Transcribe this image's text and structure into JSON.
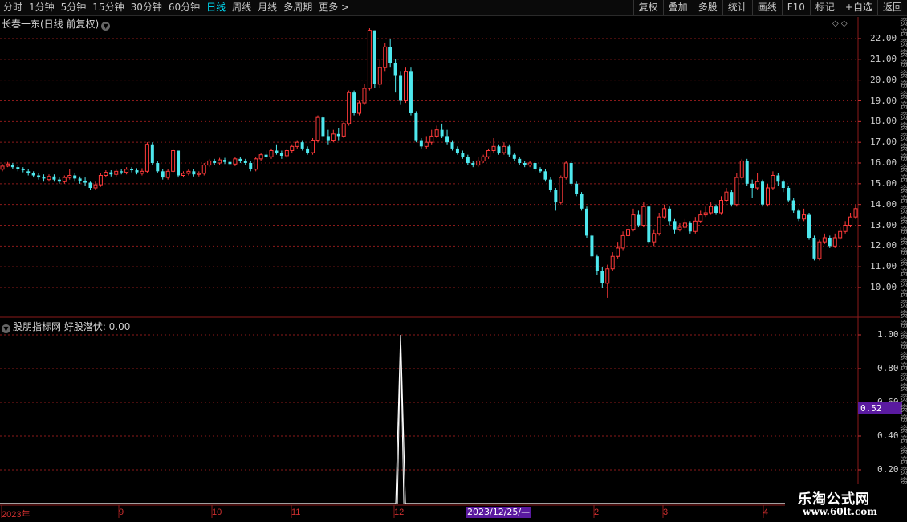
{
  "toolbar": {
    "left": [
      "分时",
      "1分钟",
      "5分钟",
      "15分钟",
      "30分钟",
      "60分钟",
      "日线",
      "周线",
      "月线",
      "多周期",
      "更多 >"
    ],
    "active_index": 6,
    "right": [
      "复权",
      "叠加",
      "多股",
      "统计",
      "画线",
      "F10",
      "标记",
      "+自选",
      "返回"
    ]
  },
  "main_panel": {
    "title": "长春一东(日线 前复权)",
    "y_labels": [
      "22.00",
      "21.00",
      "20.00",
      "19.00",
      "18.00",
      "17.00",
      "16.00",
      "15.00",
      "14.00",
      "13.00",
      "12.00",
      "11.00",
      "10.00"
    ]
  },
  "indicator_panel": {
    "title": "股朋指标网 好股潜伏: 0.00",
    "y_labels": [
      "1.00",
      "0.80",
      "0.60",
      "0.40",
      "0.20"
    ],
    "current_value": "0.52"
  },
  "x_axis": {
    "labels": [
      "2023年",
      "9",
      "10",
      "11",
      "12",
      "2",
      "3",
      "4"
    ],
    "crosshair_date": "2023/12/25/—"
  },
  "watermark": {
    "line1": "乐淘公式网",
    "line2": "www.60lt.com"
  },
  "colors": {
    "up": "#ff3a3a",
    "down": "#4ee8ee",
    "grid": "#8b1a1a",
    "indicator": "#ffffff"
  },
  "chart_data": {
    "type": "candlestick",
    "title": "长春一东(日线 前复权)",
    "ylim": [
      9.3,
      22.5
    ],
    "ticks": [
      22,
      21,
      20,
      19,
      18,
      17,
      16,
      15,
      14,
      13,
      12,
      11,
      10
    ],
    "candles": [
      [
        15.7,
        15.85,
        15.95,
        15.6
      ],
      [
        15.85,
        15.95,
        16.05,
        15.8
      ],
      [
        15.9,
        15.8,
        16.0,
        15.7
      ],
      [
        15.8,
        15.7,
        15.9,
        15.6
      ],
      [
        15.7,
        15.65,
        15.8,
        15.55
      ],
      [
        15.6,
        15.5,
        15.7,
        15.4
      ],
      [
        15.5,
        15.4,
        15.6,
        15.3
      ],
      [
        15.4,
        15.3,
        15.5,
        15.2
      ],
      [
        15.3,
        15.25,
        15.45,
        15.1
      ],
      [
        15.2,
        15.35,
        15.45,
        15.1
      ],
      [
        15.35,
        15.2,
        15.45,
        15.1
      ],
      [
        15.2,
        15.1,
        15.3,
        15.0
      ],
      [
        15.1,
        15.3,
        15.4,
        15.0
      ],
      [
        15.3,
        15.4,
        15.7,
        15.2
      ],
      [
        15.4,
        15.25,
        15.5,
        15.1
      ],
      [
        15.25,
        15.15,
        15.35,
        15.0
      ],
      [
        15.15,
        15.05,
        15.3,
        14.9
      ],
      [
        15.05,
        14.8,
        15.1,
        14.7
      ],
      [
        14.8,
        14.95,
        15.1,
        14.7
      ],
      [
        14.95,
        15.4,
        15.5,
        14.85
      ],
      [
        15.4,
        15.55,
        15.65,
        15.3
      ],
      [
        15.55,
        15.45,
        15.65,
        15.35
      ],
      [
        15.45,
        15.6,
        15.7,
        15.35
      ],
      [
        15.6,
        15.55,
        15.7,
        15.45
      ],
      [
        15.55,
        15.7,
        15.8,
        15.45
      ],
      [
        15.7,
        15.65,
        15.8,
        15.55
      ],
      [
        15.65,
        15.55,
        15.75,
        15.45
      ],
      [
        15.5,
        15.6,
        15.75,
        15.4
      ],
      [
        15.6,
        16.9,
        17.0,
        15.5
      ],
      [
        16.9,
        16.0,
        17.0,
        15.9
      ],
      [
        16.0,
        15.6,
        16.1,
        15.5
      ],
      [
        15.6,
        15.3,
        15.7,
        15.2
      ],
      [
        15.3,
        15.6,
        15.7,
        15.2
      ],
      [
        15.6,
        16.6,
        16.7,
        15.5
      ],
      [
        16.6,
        15.4,
        16.6,
        15.3
      ],
      [
        15.4,
        15.5,
        15.6,
        15.3
      ],
      [
        15.5,
        15.6,
        15.7,
        15.4
      ],
      [
        15.6,
        15.45,
        15.7,
        15.35
      ],
      [
        15.45,
        15.5,
        15.6,
        15.35
      ],
      [
        15.5,
        15.9,
        16.0,
        15.4
      ],
      [
        15.9,
        16.1,
        16.2,
        15.8
      ],
      [
        16.1,
        16.0,
        16.2,
        15.9
      ],
      [
        16.0,
        16.15,
        16.25,
        15.9
      ],
      [
        16.15,
        16.05,
        16.25,
        15.95
      ],
      [
        16.05,
        15.95,
        16.15,
        15.85
      ],
      [
        15.95,
        16.2,
        16.3,
        15.85
      ],
      [
        16.2,
        16.1,
        16.3,
        16.0
      ],
      [
        16.1,
        16.0,
        16.2,
        15.9
      ],
      [
        16.0,
        15.7,
        16.1,
        15.6
      ],
      [
        15.7,
        16.2,
        16.3,
        15.6
      ],
      [
        16.2,
        16.4,
        16.5,
        16.1
      ],
      [
        16.4,
        16.3,
        16.6,
        16.2
      ],
      [
        16.3,
        16.6,
        16.7,
        16.2
      ],
      [
        16.6,
        16.5,
        16.9,
        16.4
      ],
      [
        16.5,
        16.35,
        16.6,
        16.2
      ],
      [
        16.35,
        16.6,
        16.7,
        16.25
      ],
      [
        16.6,
        16.8,
        16.9,
        16.5
      ],
      [
        16.8,
        17.0,
        17.1,
        16.7
      ],
      [
        17.0,
        16.7,
        17.1,
        16.6
      ],
      [
        16.7,
        16.5,
        16.8,
        16.4
      ],
      [
        16.5,
        17.1,
        17.2,
        16.4
      ],
      [
        17.1,
        18.2,
        18.3,
        17.0
      ],
      [
        18.2,
        17.3,
        18.3,
        17.1
      ],
      [
        17.3,
        17.1,
        17.6,
        16.9
      ],
      [
        17.1,
        17.4,
        17.6,
        17.0
      ],
      [
        17.4,
        17.3,
        17.7,
        17.1
      ],
      [
        17.3,
        17.9,
        18.0,
        17.2
      ],
      [
        17.9,
        19.4,
        19.5,
        17.8
      ],
      [
        19.4,
        18.4,
        19.5,
        18.3
      ],
      [
        18.4,
        18.9,
        19.0,
        18.3
      ],
      [
        18.9,
        19.6,
        19.8,
        18.8
      ],
      [
        19.6,
        22.4,
        22.5,
        19.5
      ],
      [
        22.4,
        19.8,
        22.4,
        19.6
      ],
      [
        19.8,
        20.6,
        21.0,
        19.6
      ],
      [
        20.6,
        21.6,
        21.8,
        20.4
      ],
      [
        21.6,
        20.8,
        22.0,
        20.6
      ],
      [
        20.8,
        20.2,
        21.0,
        19.4
      ],
      [
        20.2,
        19.0,
        20.4,
        18.8
      ],
      [
        19.0,
        20.4,
        20.6,
        18.9
      ],
      [
        20.4,
        18.4,
        20.6,
        18.3
      ],
      [
        18.4,
        17.1,
        18.5,
        17.0
      ],
      [
        17.1,
        16.8,
        17.2,
        16.7
      ],
      [
        16.8,
        17.0,
        17.3,
        16.7
      ],
      [
        17.0,
        17.3,
        17.6,
        16.9
      ],
      [
        17.3,
        17.6,
        17.8,
        17.2
      ],
      [
        17.6,
        17.3,
        17.9,
        17.2
      ],
      [
        17.3,
        17.0,
        17.6,
        16.9
      ],
      [
        17.0,
        16.7,
        17.1,
        16.6
      ],
      [
        16.7,
        16.5,
        16.8,
        16.4
      ],
      [
        16.5,
        16.3,
        16.6,
        16.2
      ],
      [
        16.3,
        16.0,
        16.4,
        15.9
      ],
      [
        16.0,
        15.9,
        16.1,
        15.8
      ],
      [
        15.9,
        16.1,
        16.3,
        15.8
      ],
      [
        16.1,
        16.3,
        16.4,
        16.0
      ],
      [
        16.3,
        16.6,
        16.7,
        16.2
      ],
      [
        16.6,
        16.8,
        17.2,
        16.5
      ],
      [
        16.8,
        16.5,
        16.9,
        16.4
      ],
      [
        16.5,
        16.8,
        17.0,
        16.4
      ],
      [
        16.8,
        16.4,
        16.9,
        16.3
      ],
      [
        16.4,
        16.2,
        16.5,
        16.1
      ],
      [
        16.2,
        16.0,
        16.3,
        15.9
      ],
      [
        16.0,
        15.9,
        16.1,
        15.8
      ],
      [
        15.9,
        16.0,
        16.1,
        15.8
      ],
      [
        16.0,
        15.7,
        16.1,
        15.6
      ],
      [
        15.7,
        15.6,
        15.8,
        15.5
      ],
      [
        15.6,
        15.2,
        15.7,
        15.1
      ],
      [
        15.2,
        14.7,
        15.3,
        14.6
      ],
      [
        14.7,
        14.1,
        14.8,
        13.7
      ],
      [
        14.1,
        15.3,
        15.4,
        14.0
      ],
      [
        15.3,
        16.0,
        16.1,
        15.2
      ],
      [
        16.0,
        15.0,
        16.1,
        14.9
      ],
      [
        15.0,
        14.5,
        15.1,
        14.4
      ],
      [
        14.5,
        13.8,
        14.6,
        13.7
      ],
      [
        13.8,
        12.5,
        13.9,
        12.4
      ],
      [
        12.5,
        11.5,
        12.6,
        11.4
      ],
      [
        11.5,
        10.8,
        11.6,
        10.6
      ],
      [
        10.8,
        10.2,
        11.0,
        10.0
      ],
      [
        10.2,
        10.9,
        11.1,
        9.5
      ],
      [
        10.9,
        11.5,
        11.7,
        10.8
      ],
      [
        11.5,
        11.9,
        12.2,
        11.4
      ],
      [
        11.9,
        12.5,
        12.7,
        11.8
      ],
      [
        12.5,
        12.8,
        13.2,
        12.4
      ],
      [
        12.8,
        13.5,
        13.8,
        12.7
      ],
      [
        13.5,
        13.0,
        13.7,
        12.9
      ],
      [
        13.0,
        13.9,
        14.1,
        12.9
      ],
      [
        13.9,
        12.2,
        13.9,
        12.1
      ],
      [
        12.2,
        12.6,
        12.8,
        12.0
      ],
      [
        12.6,
        13.4,
        13.6,
        12.5
      ],
      [
        13.4,
        13.8,
        14.0,
        13.3
      ],
      [
        13.8,
        13.2,
        13.9,
        13.0
      ],
      [
        13.2,
        12.8,
        13.3,
        12.6
      ],
      [
        12.8,
        12.9,
        13.1,
        12.7
      ],
      [
        12.9,
        13.1,
        13.3,
        12.8
      ],
      [
        13.1,
        12.7,
        13.2,
        12.6
      ],
      [
        12.7,
        13.2,
        13.4,
        12.6
      ],
      [
        13.2,
        13.5,
        13.7,
        13.1
      ],
      [
        13.5,
        13.6,
        13.9,
        13.4
      ],
      [
        13.6,
        13.9,
        14.1,
        13.5
      ],
      [
        13.9,
        13.6,
        14.0,
        13.5
      ],
      [
        13.6,
        14.2,
        14.4,
        13.5
      ],
      [
        14.2,
        14.6,
        14.8,
        14.1
      ],
      [
        14.6,
        14.0,
        14.7,
        13.9
      ],
      [
        14.0,
        15.3,
        15.5,
        13.9
      ],
      [
        15.3,
        16.1,
        16.2,
        15.2
      ],
      [
        16.1,
        15.0,
        16.2,
        14.9
      ],
      [
        15.0,
        14.8,
        15.2,
        14.3
      ],
      [
        14.8,
        15.1,
        15.5,
        14.7
      ],
      [
        15.1,
        14.0,
        15.2,
        13.9
      ],
      [
        14.0,
        14.8,
        15.0,
        13.9
      ],
      [
        14.8,
        15.4,
        15.6,
        14.7
      ],
      [
        15.4,
        15.1,
        15.5,
        14.9
      ],
      [
        15.1,
        14.8,
        15.2,
        14.6
      ],
      [
        14.8,
        14.2,
        14.9,
        14.1
      ],
      [
        14.2,
        13.7,
        14.3,
        13.6
      ],
      [
        13.7,
        13.3,
        13.8,
        13.2
      ],
      [
        13.3,
        13.5,
        13.8,
        13.2
      ],
      [
        13.5,
        12.4,
        13.6,
        12.3
      ],
      [
        12.4,
        11.4,
        12.5,
        11.3
      ],
      [
        11.4,
        12.2,
        12.3,
        11.3
      ],
      [
        12.2,
        12.4,
        12.6,
        12.1
      ],
      [
        12.4,
        12.0,
        12.5,
        11.9
      ],
      [
        12.0,
        12.4,
        12.6,
        11.9
      ],
      [
        12.4,
        12.7,
        12.9,
        12.3
      ],
      [
        12.7,
        13.0,
        13.2,
        12.6
      ],
      [
        13.0,
        13.4,
        13.6,
        12.9
      ],
      [
        13.4,
        13.8,
        14.0,
        13.3
      ]
    ],
    "indicator": {
      "name": "好股潜伏",
      "spike_index": 77,
      "spike_value": 1.0,
      "ylim": [
        0,
        1.05
      ]
    }
  }
}
